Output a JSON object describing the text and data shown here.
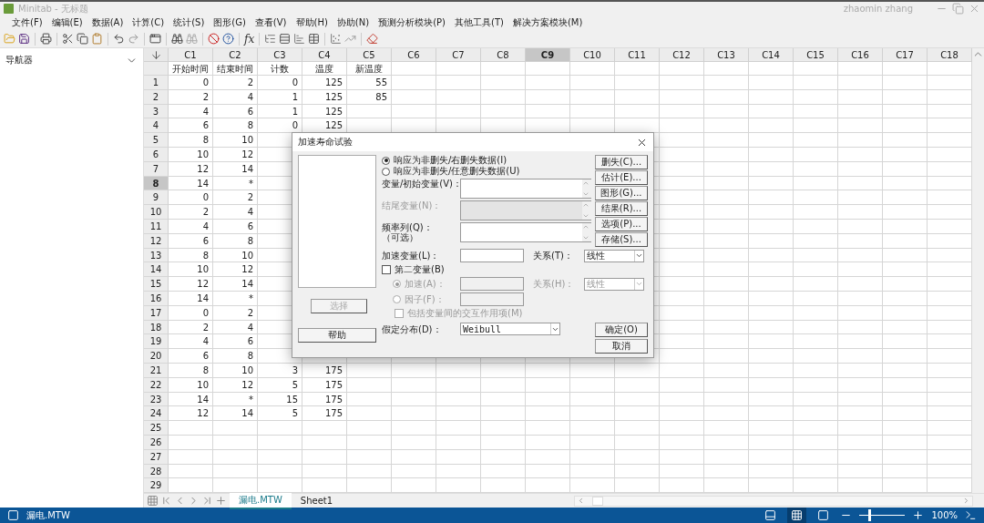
{
  "window": {
    "title": "Minitab - 无标题",
    "user": "zhaomin zhang"
  },
  "menu": [
    "文件(F)",
    "编辑(E)",
    "数据(A)",
    "计算(C)",
    "统计(S)",
    "图形(G)",
    "查看(V)",
    "帮助(H)",
    "协助(N)",
    "预测分析模块(P)",
    "其他工具(T)",
    "解决方案模块(M)"
  ],
  "toolbar": {
    "function_label": "fx"
  },
  "navigator": {
    "title": "导航器"
  },
  "worksheet": {
    "columns": [
      {
        "label": "C1",
        "name": "开始时间",
        "selected": false
      },
      {
        "label": "C2",
        "name": "结束时间",
        "selected": false
      },
      {
        "label": "C3",
        "name": "计数",
        "selected": false
      },
      {
        "label": "C4",
        "name": "温度",
        "selected": false
      },
      {
        "label": "C5",
        "name": "新温度",
        "selected": false
      },
      {
        "label": "C6",
        "selected": false
      },
      {
        "label": "C7",
        "selected": false
      },
      {
        "label": "C8",
        "selected": false
      },
      {
        "label": "C9",
        "selected": true
      },
      {
        "label": "C10",
        "selected": false
      },
      {
        "label": "C11",
        "selected": false
      },
      {
        "label": "C12",
        "selected": false
      },
      {
        "label": "C13",
        "selected": false
      },
      {
        "label": "C14",
        "selected": false
      },
      {
        "label": "C15",
        "selected": false
      },
      {
        "label": "C16",
        "selected": false
      },
      {
        "label": "C17",
        "selected": false
      },
      {
        "label": "C18",
        "selected": false
      }
    ],
    "rows": [
      {
        "number": "1",
        "selected": false,
        "cells": [
          "0",
          "2",
          "0",
          "125",
          "55"
        ]
      },
      {
        "number": "2",
        "selected": false,
        "cells": [
          "2",
          "4",
          "1",
          "125",
          "85"
        ]
      },
      {
        "number": "3",
        "selected": false,
        "cells": [
          "4",
          "6",
          "1",
          "125"
        ]
      },
      {
        "number": "4",
        "selected": false,
        "cells": [
          "6",
          "8",
          "0",
          "125"
        ]
      },
      {
        "number": "5",
        "selected": false,
        "cells": [
          "8",
          "10"
        ]
      },
      {
        "number": "6",
        "selected": false,
        "cells": [
          "10",
          "12"
        ]
      },
      {
        "number": "7",
        "selected": false,
        "cells": [
          "12",
          "14"
        ]
      },
      {
        "number": "8",
        "selected": true,
        "cells": [
          "14",
          "*"
        ]
      },
      {
        "number": "9",
        "selected": false,
        "cells": [
          "0",
          "2"
        ]
      },
      {
        "number": "10",
        "selected": false,
        "cells": [
          "2",
          "4"
        ]
      },
      {
        "number": "11",
        "selected": false,
        "cells": [
          "4",
          "6"
        ]
      },
      {
        "number": "12",
        "selected": false,
        "cells": [
          "6",
          "8"
        ]
      },
      {
        "number": "13",
        "selected": false,
        "cells": [
          "8",
          "10"
        ]
      },
      {
        "number": "14",
        "selected": false,
        "cells": [
          "10",
          "12"
        ]
      },
      {
        "number": "15",
        "selected": false,
        "cells": [
          "12",
          "14"
        ]
      },
      {
        "number": "16",
        "selected": false,
        "cells": [
          "14",
          "*"
        ]
      },
      {
        "number": "17",
        "selected": false,
        "cells": [
          "0",
          "2"
        ]
      },
      {
        "number": "18",
        "selected": false,
        "cells": [
          "2",
          "4"
        ]
      },
      {
        "number": "19",
        "selected": false,
        "cells": [
          "4",
          "6"
        ]
      },
      {
        "number": "20",
        "selected": false,
        "cells": [
          "6",
          "8"
        ]
      },
      {
        "number": "21",
        "selected": false,
        "cells": [
          "8",
          "10",
          "3",
          "175"
        ]
      },
      {
        "number": "22",
        "selected": false,
        "cells": [
          "10",
          "12",
          "5",
          "175"
        ]
      },
      {
        "number": "23",
        "selected": false,
        "cells": [
          "14",
          "*",
          "15",
          "175"
        ]
      },
      {
        "number": "24",
        "selected": false,
        "cells": [
          "12",
          "14",
          "5",
          "175"
        ]
      },
      {
        "number": "25",
        "selected": false
      },
      {
        "number": "26",
        "selected": false
      },
      {
        "number": "27",
        "selected": false
      },
      {
        "number": "28",
        "selected": false
      },
      {
        "number": "29",
        "selected": false
      }
    ],
    "sheet_tabs": [
      {
        "label": "漏电.MTW",
        "selected": true
      },
      {
        "label": "Sheet1",
        "selected": false
      }
    ]
  },
  "dialog": {
    "title": "加速寿命试验",
    "response_options": [
      {
        "label": "响应为非删失/右删失数据(I)",
        "selected": true
      },
      {
        "label": "响应为非删失/任意删失数据(U)",
        "selected": false
      }
    ],
    "variable_fields": [
      {
        "label": "变量/初始变量(V)：",
        "disabled": false
      },
      {
        "label": "结尾变量(N)：",
        "disabled": true
      },
      {
        "label": "频率列(Q)：",
        "note": "（可选）",
        "disabled": false
      }
    ],
    "accelerating_variable": {
      "label": "加速变量(L)：",
      "relation_label": "关系(T)：",
      "relation_value": "线性"
    },
    "second_variable": {
      "label": "第二变量(B)",
      "checked": false
    },
    "second_options": [
      {
        "label": "加速(A)：",
        "selected": true,
        "disabled": true,
        "relation_label": "关系(H)：",
        "relation_value": "线性"
      },
      {
        "label": "因子(F)：",
        "selected": false,
        "disabled": true
      }
    ],
    "interaction": {
      "label": "包括变量间的交互作用项(M)",
      "checked": false,
      "disabled": true
    },
    "distribution": {
      "label": "假定分布(D)：",
      "value": "Weibull"
    },
    "side_buttons": [
      "删失(C)...",
      "估计(E)...",
      "图形(G)...",
      "结果(R)...",
      "选项(P)...",
      "存储(S)..."
    ],
    "select_button": {
      "label": "选择",
      "disabled": true
    },
    "help_button": "帮助",
    "ok_button": "确定(O)",
    "cancel_button": "取消"
  },
  "status_bar": {
    "file": "漏电.MTW",
    "zoom": {
      "level": 0.2,
      "reading": "100%"
    }
  }
}
